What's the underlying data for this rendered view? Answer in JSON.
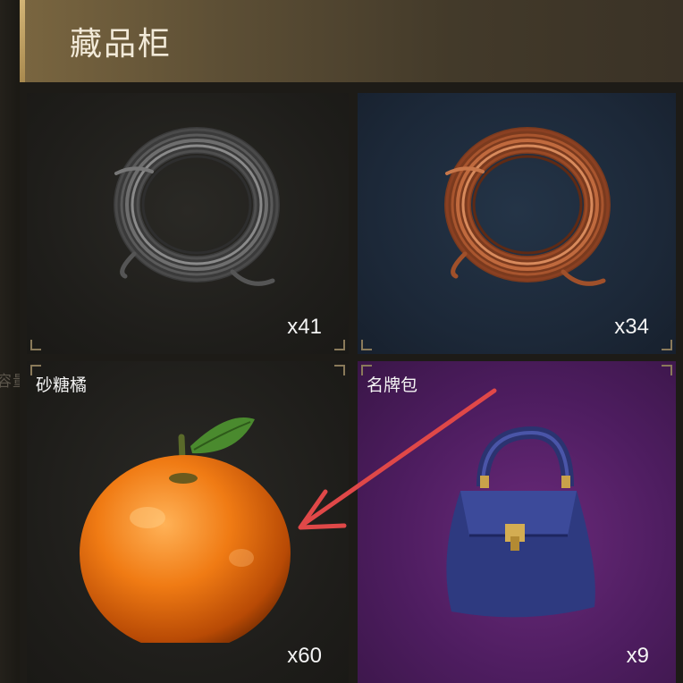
{
  "panel": {
    "title": "藏品柜",
    "side_text": "容量"
  },
  "items": [
    {
      "name": "",
      "count": "x41",
      "icon": "iron-wire-coil-icon",
      "bg": "#1e1d1a"
    },
    {
      "name": "",
      "count": "x34",
      "icon": "copper-wire-coil-icon",
      "bg": "#1c2838"
    },
    {
      "name": "砂糖橘",
      "count": "x60",
      "icon": "mandarin-orange-icon",
      "bg": "#1e1d1a"
    },
    {
      "name": "名牌包",
      "count": "x9",
      "icon": "designer-handbag-icon",
      "bg": "#4e1d60"
    }
  ],
  "colors": {
    "header_gold": "#7a6640",
    "annotation_arrow": "#e04848"
  }
}
